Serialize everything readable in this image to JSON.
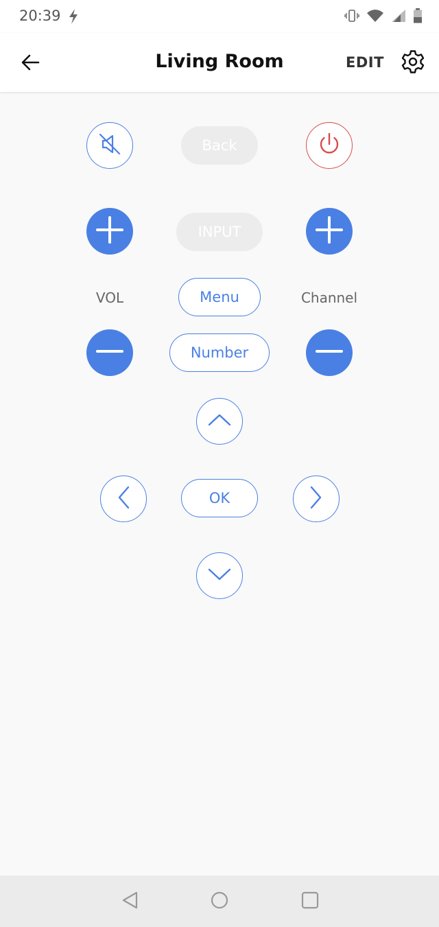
{
  "status_bar": {
    "time": "20:39",
    "icons": [
      "flash-icon",
      "vibrate-icon",
      "wifi-icon",
      "signal-icon",
      "battery-icon"
    ]
  },
  "header": {
    "title": "Living Room",
    "edit_label": "EDIT",
    "icons": [
      "arrow-left-icon",
      "gear-icon"
    ]
  },
  "remote": {
    "mute_icon": "volume-off-icon",
    "back_label": "Back",
    "power_icon": "power-icon",
    "input_label": "INPUT",
    "vol_label": "VOL",
    "channel_label": "Channel",
    "menu_label": "Menu",
    "number_label": "Number",
    "ok_label": "OK",
    "dpad_icons": [
      "chevron-up-icon",
      "chevron-left-icon",
      "chevron-right-icon",
      "chevron-down-icon"
    ]
  },
  "nav_bar": {
    "icons": [
      "nav-back-icon",
      "nav-home-icon",
      "nav-recents-icon"
    ]
  },
  "colors": {
    "accent": "#4a80e4",
    "power": "#d84a4a",
    "disabled_button": "#ececec",
    "background": "#f9f9f9"
  }
}
